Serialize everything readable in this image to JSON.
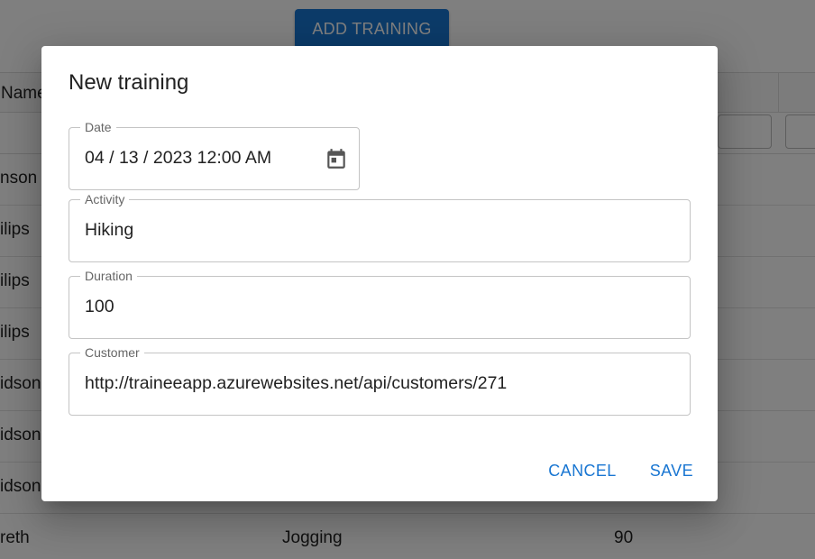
{
  "toolbar": {
    "add_training_label": "ADD TRAINING"
  },
  "grid": {
    "header_name": "Name",
    "rows": [
      {
        "name": "nson",
        "activity": "",
        "duration": ""
      },
      {
        "name": "ilips",
        "activity": "",
        "duration": ""
      },
      {
        "name": "ilips",
        "activity": "",
        "duration": ""
      },
      {
        "name": "ilips",
        "activity": "",
        "duration": ""
      },
      {
        "name": "idson",
        "activity": "",
        "duration": ""
      },
      {
        "name": "idson",
        "activity": "",
        "duration": ""
      },
      {
        "name": "idson",
        "activity": "",
        "duration": ""
      },
      {
        "name": "reth",
        "activity": "Jogging",
        "duration": "90"
      }
    ]
  },
  "dialog": {
    "title": "New training",
    "fields": {
      "date": {
        "label": "Date",
        "value": "04 / 13 / 2023 12:00 AM"
      },
      "activity": {
        "label": "Activity",
        "value": "Hiking"
      },
      "duration": {
        "label": "Duration",
        "value": "100"
      },
      "customer": {
        "label": "Customer",
        "value": "http://traineeapp.azurewebsites.net/api/customers/271"
      }
    },
    "actions": {
      "cancel_label": "CANCEL",
      "save_label": "SAVE"
    }
  },
  "icons": {
    "date_picker": "calendar-icon"
  },
  "colors": {
    "primary": "#1976d2",
    "overlay": "rgba(0,0,0,0.5)"
  }
}
